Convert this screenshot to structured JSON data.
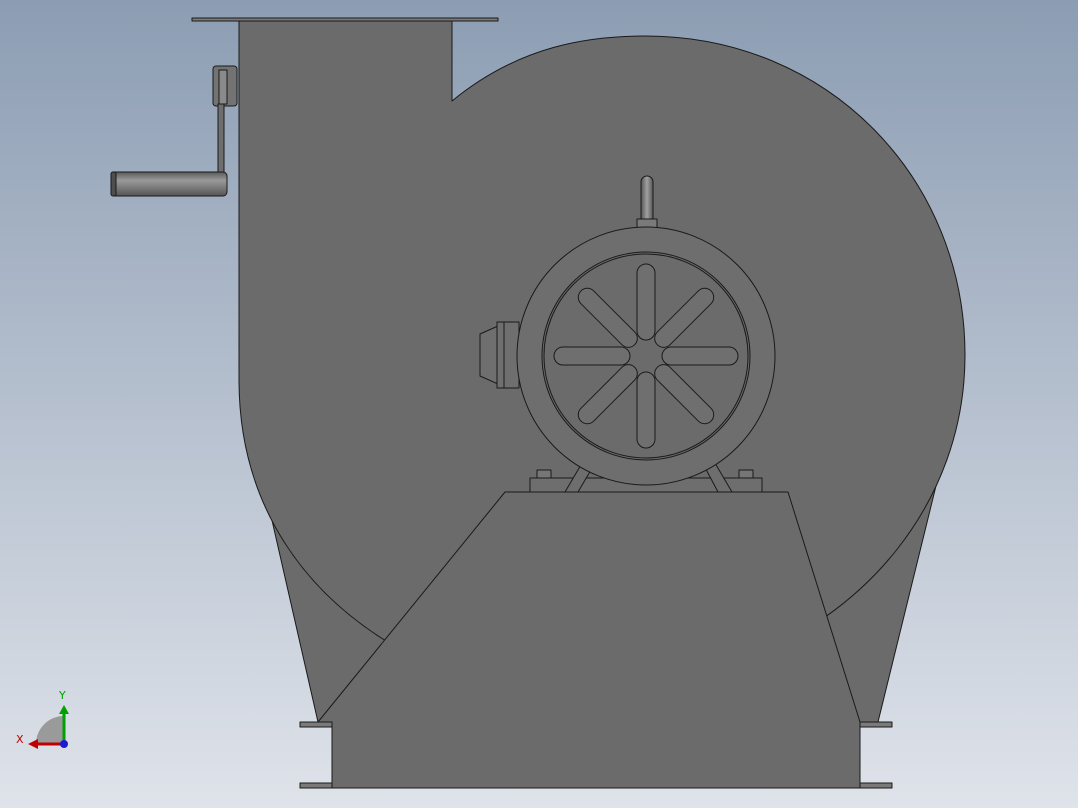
{
  "viewport": {
    "background_top": "#8c9db3",
    "background_bottom": "#dfe3ea"
  },
  "model": {
    "body_color": "#6b6b6b",
    "edge_color": "#1a1a1a",
    "motor_color": "#6e6e6e",
    "handle_color": "#767676"
  },
  "triad": {
    "x_label": "X",
    "y_label": "Y",
    "x_color": "#c00000",
    "y_color": "#00a000",
    "z_color": "#1b1bd0"
  }
}
